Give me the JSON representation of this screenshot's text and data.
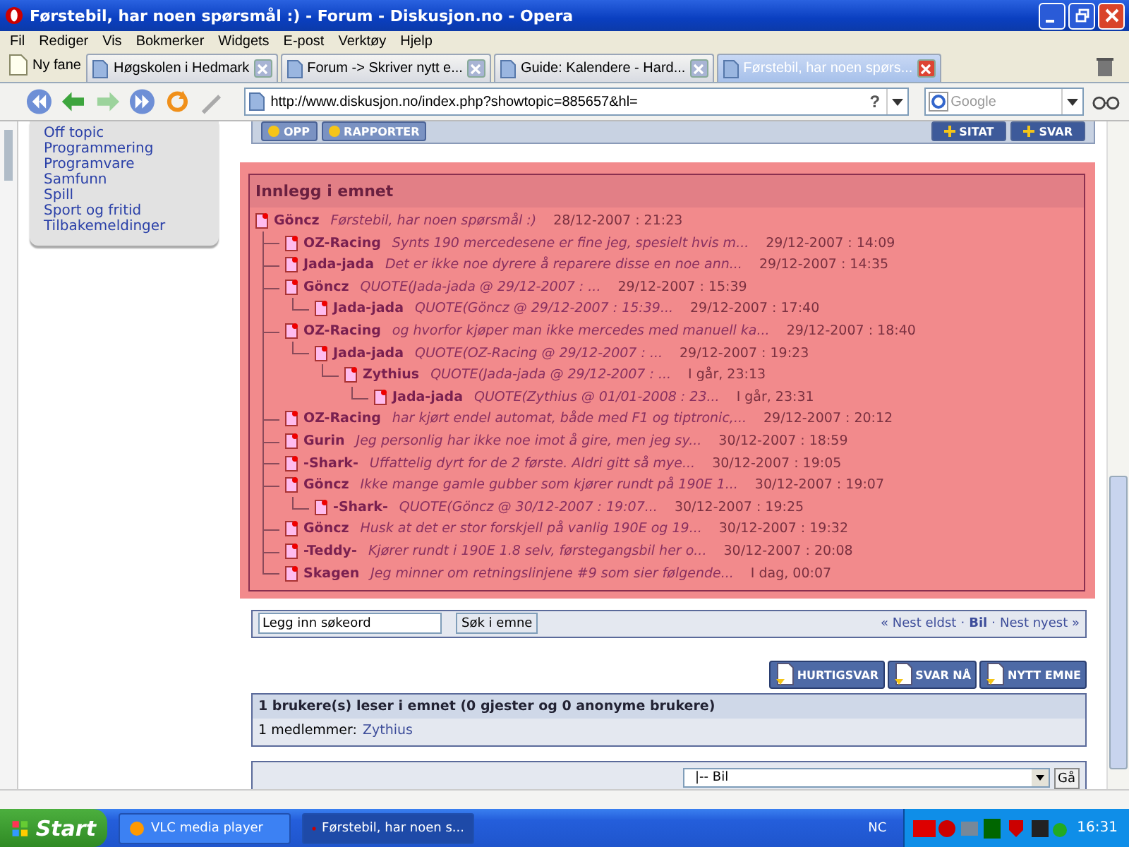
{
  "window": {
    "title": "Førstebil, har noen spørsmål :) - Forum - Diskusjon.no - Opera"
  },
  "menu": [
    "Fil",
    "Rediger",
    "Vis",
    "Bokmerker",
    "Widgets",
    "E-post",
    "Verktøy",
    "Hjelp"
  ],
  "new_tab": "Ny fane",
  "tabs": [
    {
      "label": "Høgskolen i Hedmark",
      "selected": false
    },
    {
      "label": "Forum -> Skriver nytt e...",
      "selected": false
    },
    {
      "label": "Guide: Kalendere - Hard...",
      "selected": false
    },
    {
      "label": "Førstebil, har noen spørs...",
      "selected": true
    }
  ],
  "address": {
    "url": "http://www.diskusjon.no/index.php?showtopic=885657&hl=",
    "help": "?"
  },
  "search": {
    "placeholder": "Google"
  },
  "sidebar": {
    "items": [
      "Off topic",
      "Programmering",
      "Programvare",
      "Samfunn",
      "Spill",
      "Sport og fritid",
      "Tilbakemeldinger"
    ]
  },
  "post_toolbar": {
    "left": [
      "OPP",
      "RAPPORTER"
    ],
    "right": [
      "SITAT",
      "SVAR"
    ]
  },
  "thread": {
    "title": "Innlegg i emnet",
    "posts": [
      {
        "author": "Göncz",
        "excerpt": "Førstebil, har noen spørsmål :)",
        "date": "28/12-2007 : 21:23",
        "children": [
          {
            "author": "OZ-Racing",
            "excerpt": "Synts 190 mercedesene er fine jeg, spesielt hvis m...",
            "date": "29/12-2007 : 14:09"
          },
          {
            "author": "Jada-jada",
            "excerpt": "Det er ikke noe dyrere å reparere disse en noe ann...",
            "date": "29/12-2007 : 14:35"
          },
          {
            "author": "Göncz",
            "excerpt": "QUOTE(Jada-jada @ 29/12-2007 : ...",
            "date": "29/12-2007 : 15:39",
            "children": [
              {
                "author": "Jada-jada",
                "excerpt": "QUOTE(Göncz @ 29/12-2007 : 15:39...",
                "date": "29/12-2007 : 17:40"
              }
            ]
          },
          {
            "author": "OZ-Racing",
            "excerpt": "og hvorfor kjøper man ikke mercedes med manuell ka...",
            "date": "29/12-2007 : 18:40",
            "children": [
              {
                "author": "Jada-jada",
                "excerpt": "QUOTE(OZ-Racing @ 29/12-2007 : ...",
                "date": "29/12-2007 : 19:23",
                "children": [
                  {
                    "author": "Zythius",
                    "excerpt": "QUOTE(Jada-jada @ 29/12-2007 : ...",
                    "date": "I går, 23:13",
                    "children": [
                      {
                        "author": "Jada-jada",
                        "excerpt": "QUOTE(Zythius @ 01/01-2008 : 23...",
                        "date": "I går, 23:31"
                      }
                    ]
                  }
                ]
              }
            ]
          },
          {
            "author": "OZ-Racing",
            "excerpt": "har kjørt endel automat, både med F1 og tiptronic,...",
            "date": "29/12-2007 : 20:12"
          },
          {
            "author": "Gurin",
            "excerpt": "Jeg personlig har ikke noe imot å gire, men jeg sy...",
            "date": "30/12-2007 : 18:59"
          },
          {
            "author": "-Shark-",
            "excerpt": "Uffattelig dyrt for de 2 første. Aldri gitt så mye...",
            "date": "30/12-2007 : 19:05"
          },
          {
            "author": "Göncz",
            "excerpt": "Ikke mange gamle gubber som kjører rundt på 190E 1...",
            "date": "30/12-2007 : 19:07",
            "children": [
              {
                "author": "-Shark-",
                "excerpt": "QUOTE(Göncz @ 30/12-2007 : 19:07...",
                "date": "30/12-2007 : 19:25"
              }
            ]
          },
          {
            "author": "Göncz",
            "excerpt": "Husk at det er stor forskjell på vanlig 190E og 19...",
            "date": "30/12-2007 : 19:32"
          },
          {
            "author": "-Teddy-",
            "excerpt": "Kjører rundt i 190E 1.8 selv, førstegangsbil her o...",
            "date": "30/12-2007 : 20:08"
          },
          {
            "author": "Skagen",
            "excerpt": "Jeg minner om retningslinjene #9 som sier følgende...",
            "date": "I dag, 00:07"
          }
        ]
      }
    ]
  },
  "topic_search": {
    "value": "Legg inn søkeord",
    "button": "Søk i emne"
  },
  "topic_nav": [
    {
      "kind": "link",
      "label": "« Nest eldst",
      "current": false
    },
    {
      "kind": "separator",
      "label": "·"
    },
    {
      "kind": "link",
      "label": "Bil",
      "current": true
    },
    {
      "kind": "separator",
      "label": "·"
    },
    {
      "kind": "link",
      "label": "Nest nyest »",
      "current": false
    }
  ],
  "reply_buttons": [
    "HURTIGSVAR",
    "SVAR NÅ",
    "NYTT EMNE"
  ],
  "readers": {
    "title": "1 brukere(s) leser i emnet (0 gjester og 0 anonyme brukere)",
    "members_label": "1 medlemmer:",
    "members": [
      "Zythius"
    ]
  },
  "forum_jump": {
    "value": "|-- Bil",
    "button": "Gå"
  },
  "taskbar": {
    "start": "Start",
    "tasks": [
      {
        "label": "VLC media player",
        "selected": false
      },
      {
        "label": "Førstebil, har noen s...",
        "selected": true
      }
    ],
    "lang": "NC",
    "clock": "16:31"
  }
}
